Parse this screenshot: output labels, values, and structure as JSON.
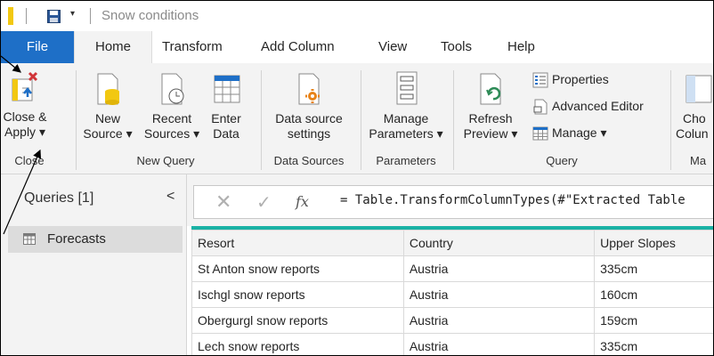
{
  "titlebar": {
    "title": "Snow conditions",
    "save_icon": "save-icon",
    "customize_arrow": "▾"
  },
  "tabs": [
    {
      "label": "File"
    },
    {
      "label": "Home"
    },
    {
      "label": "Transform"
    },
    {
      "label": "Add Column"
    },
    {
      "label": "View"
    },
    {
      "label": "Tools"
    },
    {
      "label": "Help"
    }
  ],
  "ribbon": {
    "close": {
      "close_apply_line1": "Close &",
      "close_apply_line2": "Apply ▾",
      "group_label": "Close"
    },
    "new_query": {
      "new_source_line1": "New",
      "new_source_line2": "Source ▾",
      "recent_sources_line1": "Recent",
      "recent_sources_line2": "Sources ▾",
      "enter_data_line1": "Enter",
      "enter_data_line2": "Data",
      "group_label": "New Query"
    },
    "data_sources": {
      "settings_line1": "Data source",
      "settings_line2": "settings",
      "group_label": "Data Sources"
    },
    "parameters": {
      "manage_line1": "Manage",
      "manage_line2": "Parameters ▾",
      "group_label": "Parameters"
    },
    "query": {
      "refresh_line1": "Refresh",
      "refresh_line2": "Preview ▾",
      "properties": "Properties",
      "advanced_editor": "Advanced Editor",
      "manage": "Manage ▾",
      "group_label": "Query"
    },
    "manage_columns": {
      "choose_line1": "Cho",
      "choose_line2": "Colun",
      "group_label": "Ma"
    }
  },
  "queries_panel": {
    "title": "Queries [1]",
    "collapse": "<",
    "items": [
      {
        "label": "Forecasts"
      }
    ]
  },
  "formula_bar": {
    "cancel": "✕",
    "commit": "✓",
    "fx": "fx",
    "formula": "= Table.TransformColumnTypes(#\"Extracted Table"
  },
  "table": {
    "columns": [
      "Resort",
      "Country",
      "Upper Slopes"
    ],
    "rows": [
      [
        "St Anton snow reports",
        "Austria",
        "335cm"
      ],
      [
        "Ischgl snow reports",
        "Austria",
        "160cm"
      ],
      [
        "Obergurgl snow reports",
        "Austria",
        "159cm"
      ],
      [
        "Lech snow reports",
        "Austria",
        "335cm"
      ]
    ]
  },
  "colors": {
    "file_tab": "#1e6fc7",
    "ribbon_bg": "#f3f3f3",
    "grid_accent": "#1ab2a5",
    "logo": "#f2c811"
  }
}
